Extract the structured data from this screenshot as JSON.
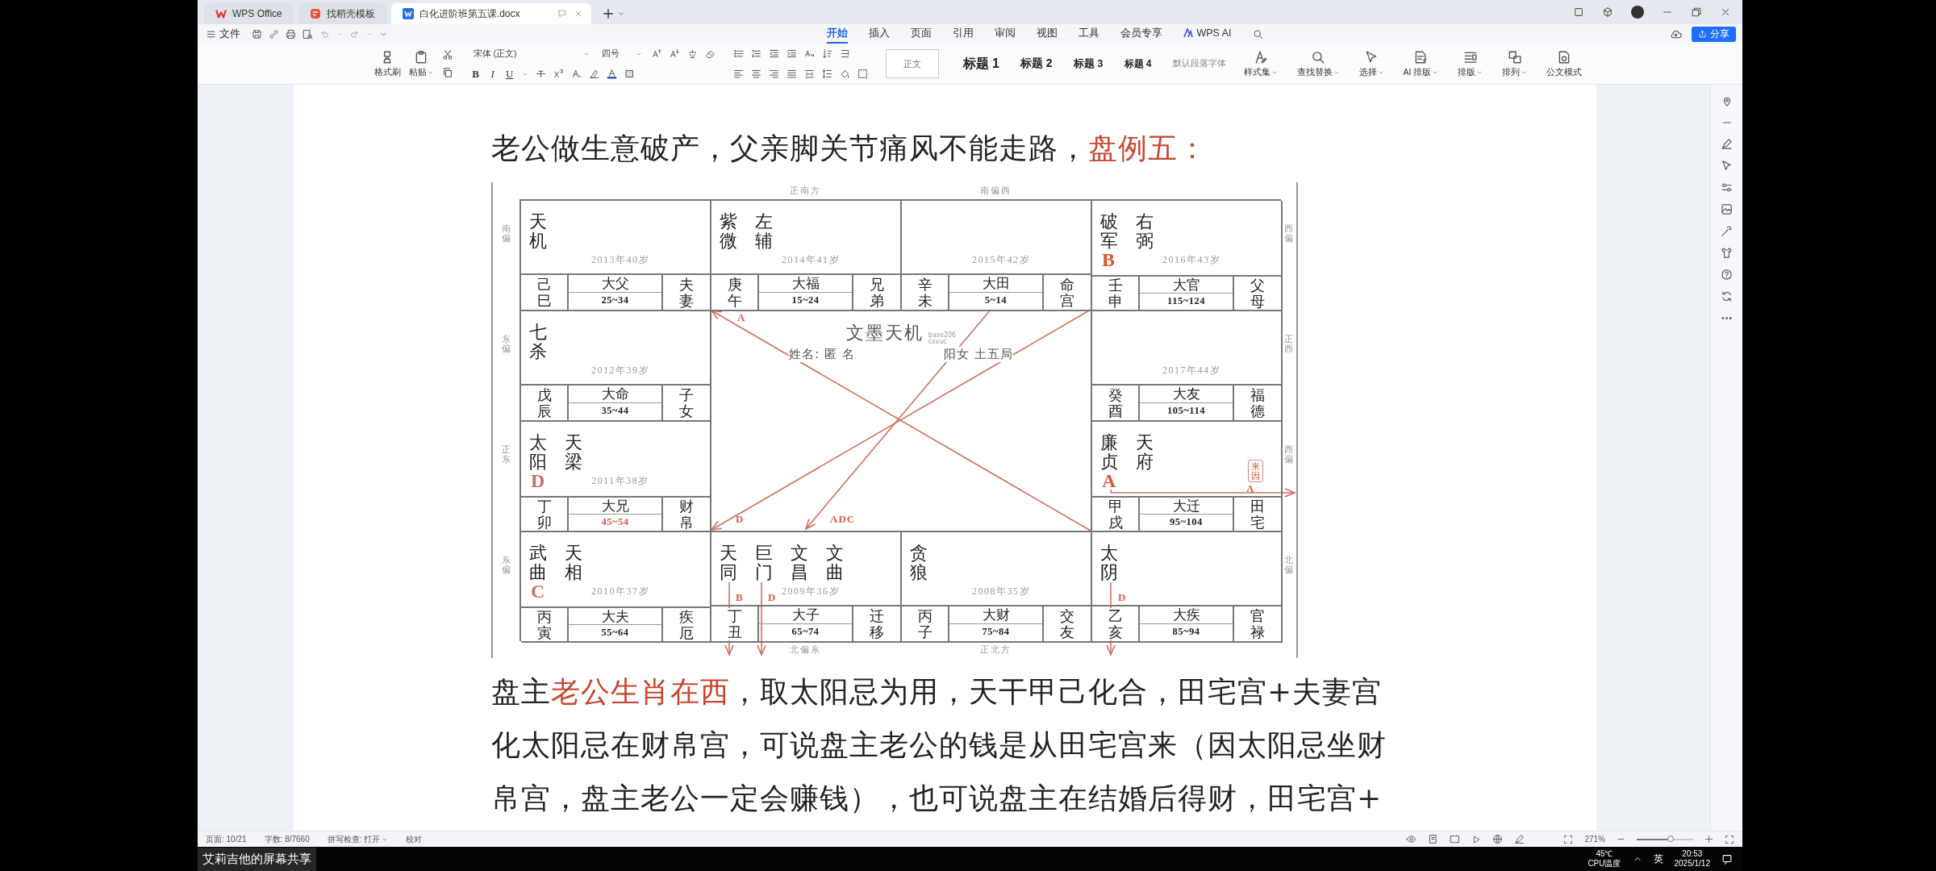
{
  "title_tabs": [
    {
      "label": "WPS Office",
      "kind": "home",
      "selected": false
    },
    {
      "label": "找稻壳模板",
      "kind": "template",
      "selected": false
    },
    {
      "label": "白化进阶班第五课.docx",
      "kind": "document",
      "selected": true
    }
  ],
  "quick_access": {
    "file_menu": "文件"
  },
  "menu_tabs": [
    {
      "label": "开始",
      "kind": "tab",
      "selected": true
    },
    {
      "label": "插入",
      "kind": "tab",
      "selected": false
    },
    {
      "label": "页面",
      "kind": "tab",
      "selected": false
    },
    {
      "label": "引用",
      "kind": "tab",
      "selected": false
    },
    {
      "label": "审阅",
      "kind": "tab",
      "selected": false
    },
    {
      "label": "视图",
      "kind": "tab",
      "selected": false
    },
    {
      "label": "工具",
      "kind": "tab",
      "selected": false
    },
    {
      "label": "会员专享",
      "kind": "tab",
      "selected": false
    },
    {
      "label": "WPS AI",
      "kind": "ai",
      "selected": false
    }
  ],
  "share_button": "分享",
  "ribbon": {
    "clipboard": [
      {
        "label": "格式刷",
        "kind": "painter",
        "dropdown": false
      },
      {
        "label": "粘贴",
        "kind": "paste",
        "dropdown": true
      }
    ],
    "font_name": "宋体 (正文)",
    "font_size": "四号",
    "text_format": [
      {
        "label": "B",
        "kind": "bold"
      },
      {
        "label": "I",
        "kind": "italic"
      },
      {
        "label": "U",
        "kind": "underline"
      }
    ],
    "styles": [
      {
        "label": "正文",
        "kind": "body"
      },
      {
        "label": "标题 1",
        "kind": "heading1"
      },
      {
        "label": "标题 2",
        "kind": "heading2"
      },
      {
        "label": "标题 3",
        "kind": "heading3"
      },
      {
        "label": "标题 4",
        "kind": "heading4"
      },
      {
        "label": "默认段落字体",
        "kind": "default"
      }
    ],
    "tools": [
      {
        "label": "样式集",
        "kind": "styleset",
        "dropdown": true
      },
      {
        "label": "查找替换",
        "kind": "find",
        "dropdown": true
      },
      {
        "label": "选择",
        "kind": "select",
        "dropdown": true
      },
      {
        "label": "AI 排版",
        "kind": "ai_layout",
        "dropdown": true
      },
      {
        "label": "排版",
        "kind": "layout",
        "dropdown": true
      },
      {
        "label": "排列",
        "kind": "arrange",
        "dropdown": true
      },
      {
        "label": "公文模式",
        "kind": "official",
        "dropdown": false
      }
    ]
  },
  "document": {
    "heading": [
      {
        "text": "老公做生意破产，父亲脚关节痛风不能走路，",
        "emphasis": false
      },
      {
        "text": "盘例五：",
        "emphasis": true
      }
    ],
    "chart": {
      "compass": {
        "top": [
          "正南方",
          "南偏西"
        ],
        "bottom": [
          "北偏东",
          "正北方"
        ],
        "left": [
          "南偏",
          "东偏",
          "正东",
          "东偏"
        ],
        "right": [
          "西偏",
          "正西",
          "西偏",
          "北偏"
        ]
      },
      "center": {
        "title": "文墨天机",
        "version": [
          "base206",
          "csvuc"
        ],
        "name_line": "姓名: 匿 名",
        "info": "阳女 土五局"
      },
      "palaces": [
        {
          "stars": [
            "天机"
          ],
          "year": "2013年40岁",
          "stem": "己巳",
          "major": "大父",
          "range": "25~34",
          "range_highlight": false,
          "palace": "夫妻"
        },
        {
          "stars": [
            "紫微",
            "左辅"
          ],
          "year": "2014年41岁",
          "stem": "庚午",
          "major": "大福",
          "range": "15~24",
          "range_highlight": false,
          "palace": "兄弟"
        },
        {
          "year": "2015年42岁",
          "stem": "辛未",
          "major": "大田",
          "range": "5~14",
          "range_highlight": false,
          "palace": "命宫"
        },
        {
          "stars": [
            "破军",
            "右弼"
          ],
          "marker": {
            "letter": "B",
            "color": "#e4532c"
          },
          "year": "2016年43岁",
          "stem": "壬申",
          "major": "大官",
          "range": "115~124",
          "range_highlight": false,
          "palace": "父母"
        },
        {
          "stars": [
            "七杀"
          ],
          "year": "2012年39岁",
          "stem": "戊辰",
          "major": "大命",
          "range": "35~44",
          "range_highlight": false,
          "palace": "子女"
        },
        {
          "year": "2017年44岁",
          "stem": "癸酉",
          "major": "大友",
          "range": "105~114",
          "range_highlight": false,
          "palace": "福德"
        },
        {
          "stars": [
            "太阳",
            "天梁"
          ],
          "marker": {
            "letter": "D",
            "color": "#c4706a"
          },
          "year": "2011年38岁",
          "stem": "丁卯",
          "major": "大兄",
          "range": "45~54",
          "range_highlight": true,
          "palace": "财帛"
        },
        {
          "stars": [
            "廉贞",
            "天府"
          ],
          "marker": {
            "letter": "A",
            "color": "#e0573f"
          },
          "stem": "甲戌",
          "major": "大迁",
          "range": "95~104",
          "range_highlight": false,
          "palace": "田宅"
        },
        {
          "stars": [
            "武曲",
            "天相"
          ],
          "marker": {
            "letter": "C",
            "color": "#c4706a"
          },
          "year": "2010年37岁",
          "stem": "丙寅",
          "major": "大夫",
          "range": "55~64",
          "range_highlight": false,
          "palace": "疾厄"
        },
        {
          "stars": [
            "天同",
            "巨门",
            "文昌",
            "文曲"
          ],
          "year": "2009年36岁",
          "stem": "丁丑",
          "major": "大子",
          "range": "65~74",
          "range_highlight": false,
          "palace": "迁移"
        },
        {
          "stars": [
            "贪狼"
          ],
          "year": "2008年35岁",
          "stem": "丙子",
          "major": "大财",
          "range": "75~84",
          "range_highlight": false,
          "palace": "交友"
        },
        {
          "stars": [
            "太阴"
          ],
          "stem": "乙亥",
          "major": "大疾",
          "range": "85~94",
          "range_highlight": false,
          "palace": "官禄"
        }
      ],
      "arrow_labels": [
        "A",
        "D",
        "ADC",
        "B",
        "D",
        "D",
        "A"
      ],
      "stamp": "来因"
    },
    "paragraph": [
      {
        "text": "盘主",
        "emphasis": false
      },
      {
        "text": "老公生肖在西",
        "emphasis": true
      },
      {
        "text": "，取太阳忌为用，天干甲己化合，田宅宫+夫妻宫化太阳忌在财帛宫，可说盘主老公的钱是从田宅宫来（因太阳忌坐财帛宫，盘主老公一定会赚钱），也可说盘主在结婚后得财，田宅宫+",
        "emphasis": false
      }
    ]
  },
  "status_bar": {
    "page": "页面: 10/21",
    "words": "字数: 8/7660",
    "spellcheck": "拼写检查: 打开",
    "proofread": "校对",
    "zoom": "271%",
    "zoom_slider": {
      "level": 0.6
    }
  },
  "taskbar": {
    "screen_share": "艾莉吉他的屏幕共享",
    "cpu_temp": "45℃",
    "cpu_label": "CPU温度",
    "ime": "英",
    "time": "20:53",
    "date": "2025/1/12"
  }
}
